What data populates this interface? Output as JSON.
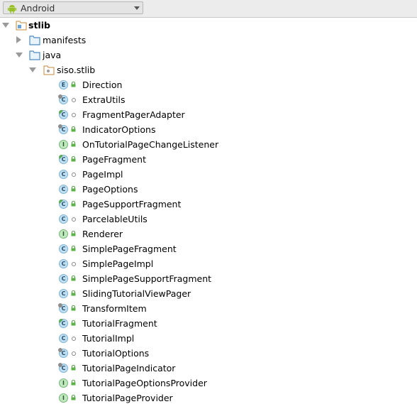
{
  "toolbar": {
    "view_selector": "Android"
  },
  "tree": {
    "root": "stlib",
    "folders": [
      "manifests",
      "java"
    ],
    "package": "siso.stlib",
    "classes": [
      {
        "name": "Direction",
        "kind": "E",
        "vis": "public"
      },
      {
        "name": "ExtraUtils",
        "kind": "C",
        "vis": "package",
        "mod": "abstract"
      },
      {
        "name": "FragmentPagerAdapter",
        "kind": "C",
        "vis": "package",
        "mod": "green"
      },
      {
        "name": "IndicatorOptions",
        "kind": "C",
        "vis": "public",
        "mod": "abstract"
      },
      {
        "name": "OnTutorialPageChangeListener",
        "kind": "I",
        "vis": "public"
      },
      {
        "name": "PageFragment",
        "kind": "C",
        "vis": "public",
        "mod": "green"
      },
      {
        "name": "PageImpl",
        "kind": "C",
        "vis": "package"
      },
      {
        "name": "PageOptions",
        "kind": "C",
        "vis": "public"
      },
      {
        "name": "PageSupportFragment",
        "kind": "C",
        "vis": "public",
        "mod": "green"
      },
      {
        "name": "ParcelableUtils",
        "kind": "C",
        "vis": "package"
      },
      {
        "name": "Renderer",
        "kind": "I",
        "vis": "public"
      },
      {
        "name": "SimplePageFragment",
        "kind": "C",
        "vis": "public"
      },
      {
        "name": "SimplePageImpl",
        "kind": "C",
        "vis": "package"
      },
      {
        "name": "SimplePageSupportFragment",
        "kind": "C",
        "vis": "public"
      },
      {
        "name": "SlidingTutorialViewPager",
        "kind": "C",
        "vis": "public"
      },
      {
        "name": "TransformItem",
        "kind": "C",
        "vis": "public",
        "mod": "abstract"
      },
      {
        "name": "TutorialFragment",
        "kind": "C",
        "vis": "public",
        "mod": "green"
      },
      {
        "name": "TutorialImpl",
        "kind": "C",
        "vis": "package"
      },
      {
        "name": "TutorialOptions",
        "kind": "C",
        "vis": "package",
        "mod": "abstract"
      },
      {
        "name": "TutorialPageIndicator",
        "kind": "C",
        "vis": "public",
        "mod": "abstract"
      },
      {
        "name": "TutorialPageOptionsProvider",
        "kind": "I",
        "vis": "public"
      },
      {
        "name": "TutorialPageProvider",
        "kind": "I",
        "vis": "public"
      }
    ]
  }
}
